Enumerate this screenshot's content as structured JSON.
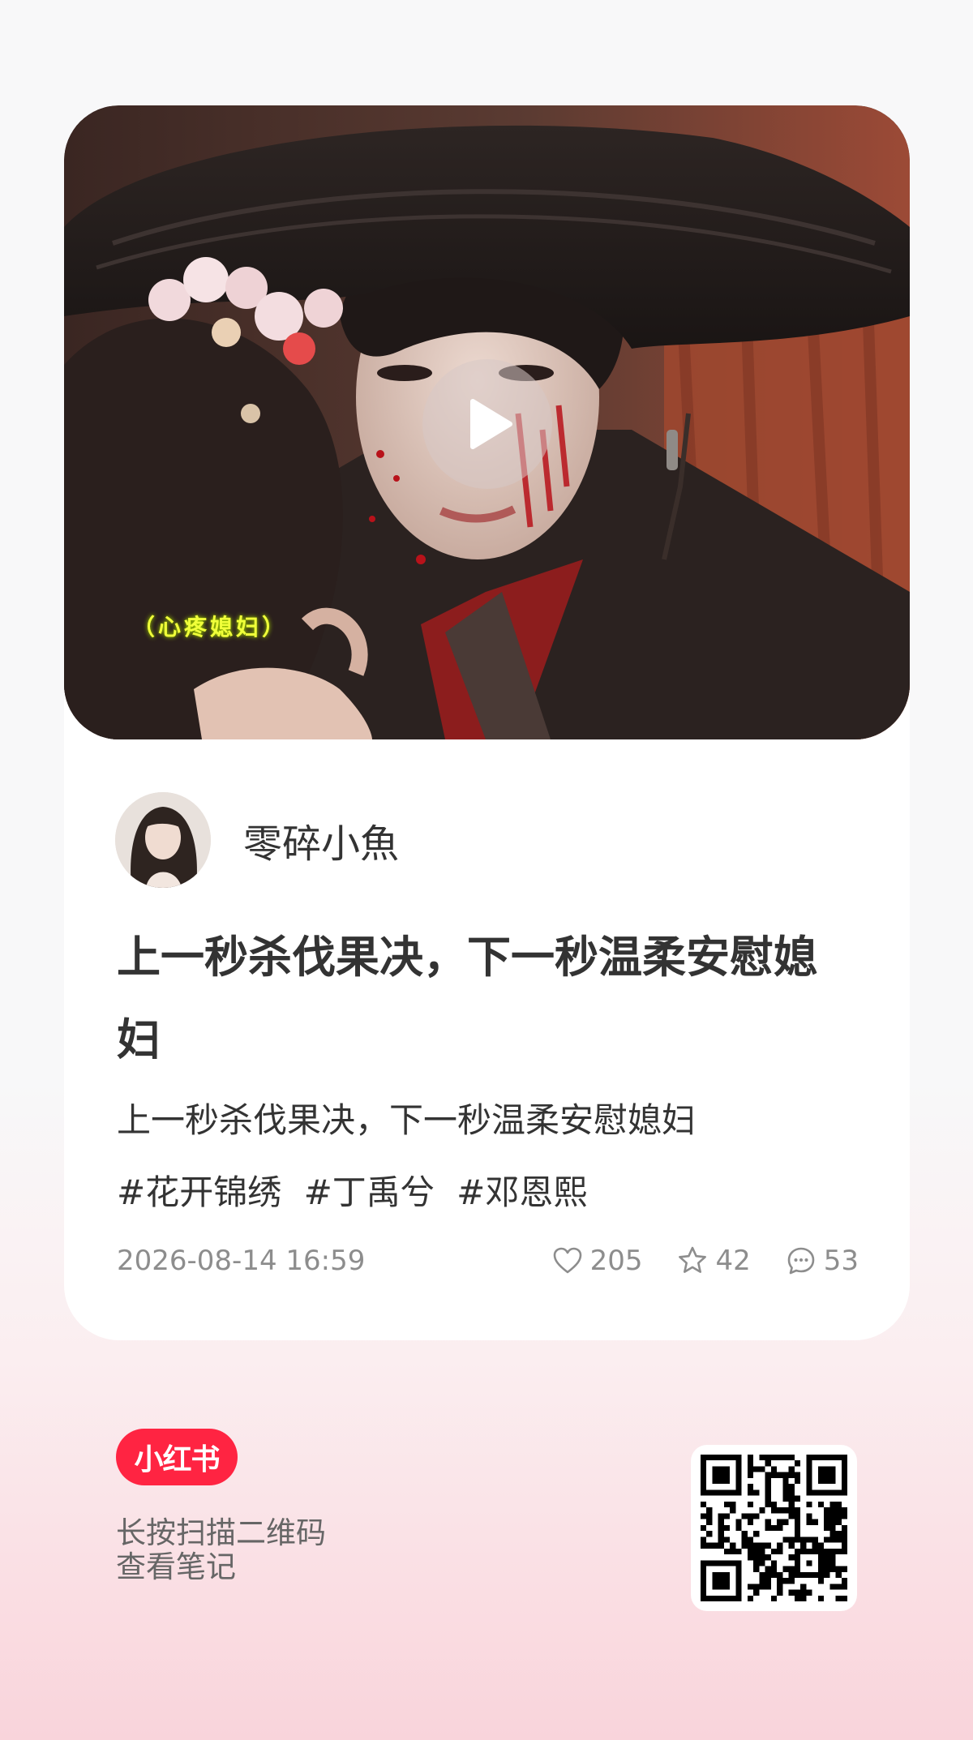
{
  "post": {
    "video_caption": "（心疼媳妇）",
    "author_name": "零碎小魚",
    "title": "上一秒杀伐果决，下一秒温柔安慰媳妇",
    "description": "上一秒杀伐果决，下一秒温柔安慰媳妇",
    "tags": [
      "#花开锦绣",
      "#丁禹兮",
      "#邓恩熙"
    ],
    "timestamp": "2026-08-14 16:59",
    "likes": "205",
    "favorites": "42",
    "comments": "53"
  },
  "footer": {
    "logo_text": "小红书",
    "line1": "长按扫描二维码",
    "line2": "查看笔记"
  },
  "colors": {
    "brand": "#ff2442",
    "caption": "#f0ff3a",
    "text": "#333333",
    "meta": "#8d8d8d"
  },
  "icons": {
    "play": "play-icon",
    "like": "heart-icon",
    "favorite": "star-icon",
    "comment": "comment-bubble-icon"
  }
}
